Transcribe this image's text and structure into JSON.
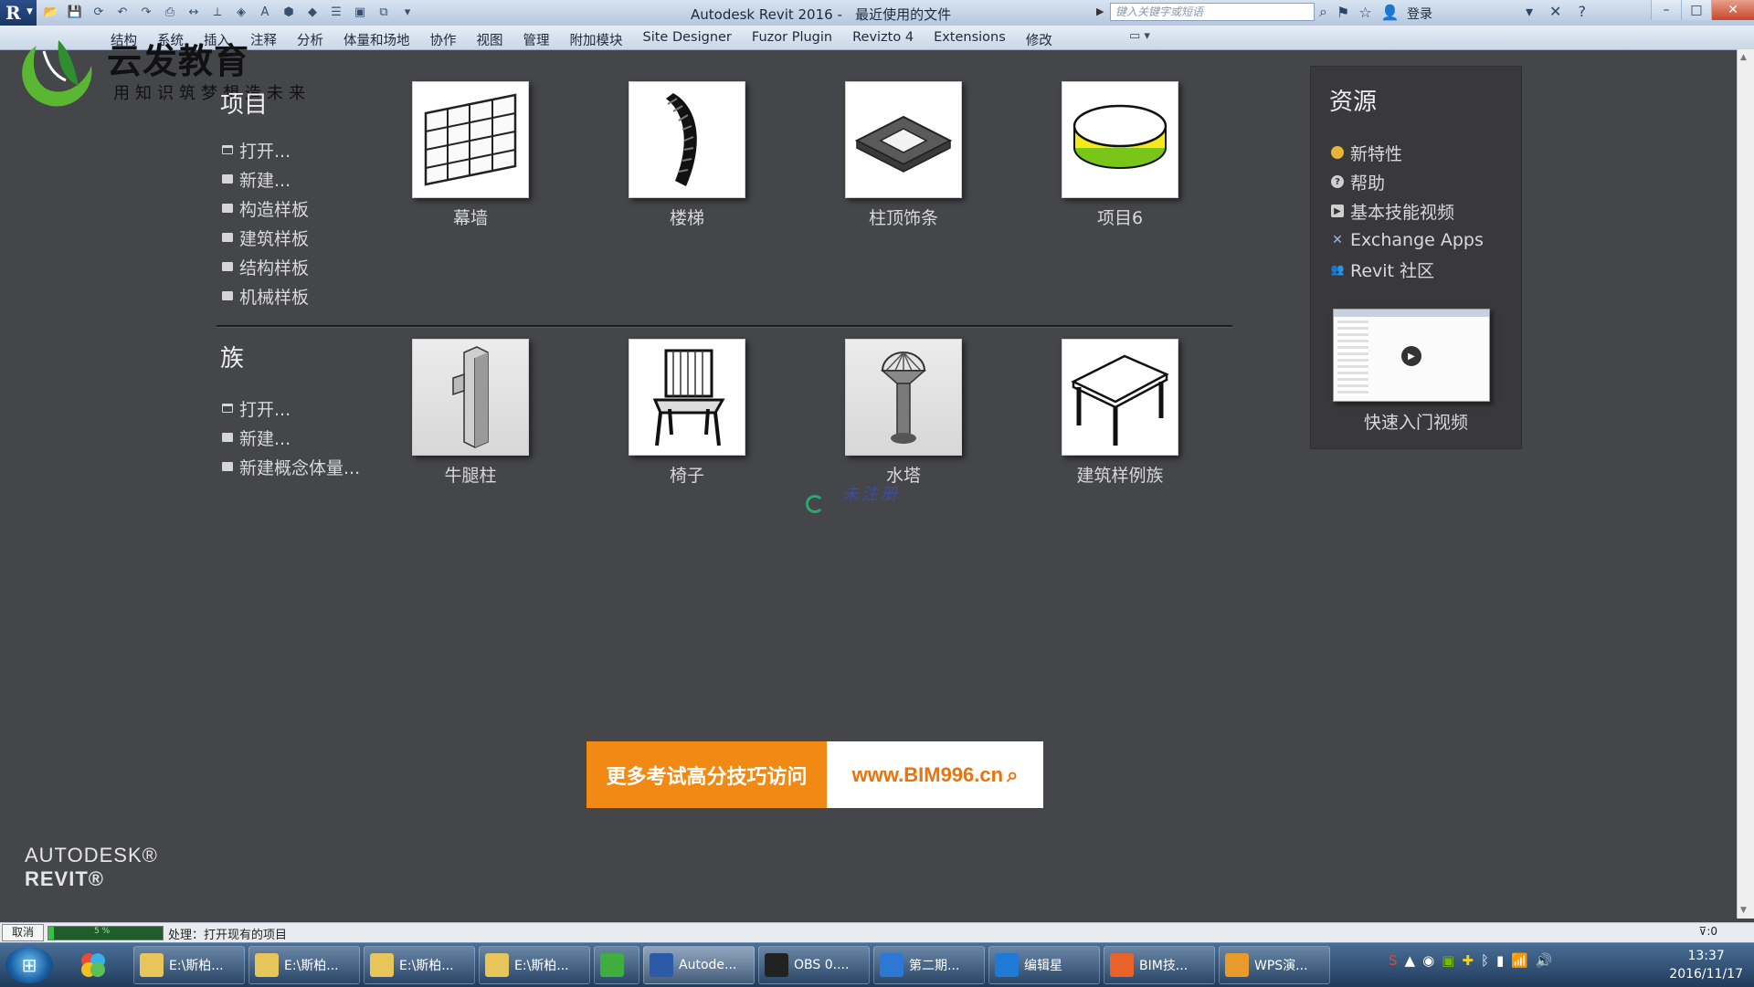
{
  "window": {
    "title": "Autodesk Revit 2016 -   最近使用的文件",
    "search_placeholder": "键入关键字或短语",
    "login_label": "登录",
    "app_logo": "R"
  },
  "ribbon": {
    "tabs": [
      "结构",
      "系统",
      "插入",
      "注释",
      "分析",
      "体量和场地",
      "协作",
      "视图",
      "管理",
      "附加模块",
      "Site Designer",
      "Fuzor Plugin",
      "Revizto 4",
      "Extensions",
      "修改"
    ]
  },
  "watermark": {
    "title": "云发教育",
    "subtitle": "用知识筑梦想造未来"
  },
  "projects": {
    "heading": "项目",
    "links": [
      {
        "label": "打开...",
        "icon": "open-folder-icon"
      },
      {
        "label": "新建...",
        "icon": "new-file-icon"
      },
      {
        "label": "构造样板",
        "icon": "template-icon"
      },
      {
        "label": "建筑样板",
        "icon": "template-icon"
      },
      {
        "label": "结构样板",
        "icon": "template-icon"
      },
      {
        "label": "机械样板",
        "icon": "template-icon"
      }
    ],
    "recent": [
      {
        "label": "幕墙",
        "icon": "curtain-wall-thumbnail"
      },
      {
        "label": "楼梯",
        "icon": "stair-thumbnail"
      },
      {
        "label": "柱顶饰条",
        "icon": "column-cap-thumbnail"
      },
      {
        "label": "项目6",
        "icon": "ring-thumbnail"
      }
    ]
  },
  "families": {
    "heading": "族",
    "links": [
      {
        "label": "打开...",
        "icon": "open-folder-icon"
      },
      {
        "label": "新建...",
        "icon": "new-file-icon"
      },
      {
        "label": "新建概念体量...",
        "icon": "mass-icon"
      }
    ],
    "recent": [
      {
        "label": "牛腿柱",
        "icon": "corbel-column-thumbnail"
      },
      {
        "label": "椅子",
        "icon": "chair-thumbnail"
      },
      {
        "label": "水塔",
        "icon": "water-tower-thumbnail"
      },
      {
        "label": "建筑样例族",
        "icon": "table-thumbnail"
      }
    ]
  },
  "loading_note": "未注册",
  "resources": {
    "heading": "资源",
    "items": [
      {
        "label": "新特性",
        "icon": "new-features-icon"
      },
      {
        "label": "帮助",
        "icon": "help-icon"
      },
      {
        "label": "基本技能视频",
        "icon": "video-icon"
      },
      {
        "label": "Exchange Apps",
        "icon": "exchange-icon"
      },
      {
        "label": "Revit 社区",
        "icon": "community-icon"
      }
    ],
    "video_caption": "快速入门视频"
  },
  "banner": {
    "left_text": "更多考试高分技巧访问",
    "url": "www.BIM996.cn"
  },
  "brand": {
    "line1": "AUTODESK®",
    "line2": "REVIT®"
  },
  "statusbar": {
    "cancel_label": "取消",
    "progress_percent": 5,
    "progress_label": "5 %",
    "status_text": "处理：打开现有的项目",
    "filter_count": ":0"
  },
  "taskbar": {
    "tasks": [
      {
        "label": "E:\\斯柏...",
        "icon": "folder-icon",
        "color": "#e8c55a"
      },
      {
        "label": "E:\\斯柏...",
        "icon": "folder-icon",
        "color": "#e8c55a"
      },
      {
        "label": "E:\\斯柏...",
        "icon": "folder-icon",
        "color": "#e8c55a"
      },
      {
        "label": "E:\\斯柏...",
        "icon": "folder-icon",
        "color": "#e8c55a"
      },
      {
        "label": "",
        "icon": "browser-icon",
        "color": "#3fae3f"
      },
      {
        "label": "Autode...",
        "icon": "revit-icon",
        "color": "#2a5aa8"
      },
      {
        "label": "OBS 0....",
        "icon": "obs-icon",
        "color": "#222222"
      },
      {
        "label": "第二期...",
        "icon": "word-icon",
        "color": "#2c78d4"
      },
      {
        "label": "编辑星",
        "icon": "video-editor-icon",
        "color": "#1f7ad6"
      },
      {
        "label": "BIM技...",
        "icon": "presentation-icon",
        "color": "#e8622a"
      },
      {
        "label": "WPS演...",
        "icon": "wps-icon",
        "color": "#e89a2a"
      }
    ],
    "time": "13:37",
    "date": "2016/11/17"
  }
}
